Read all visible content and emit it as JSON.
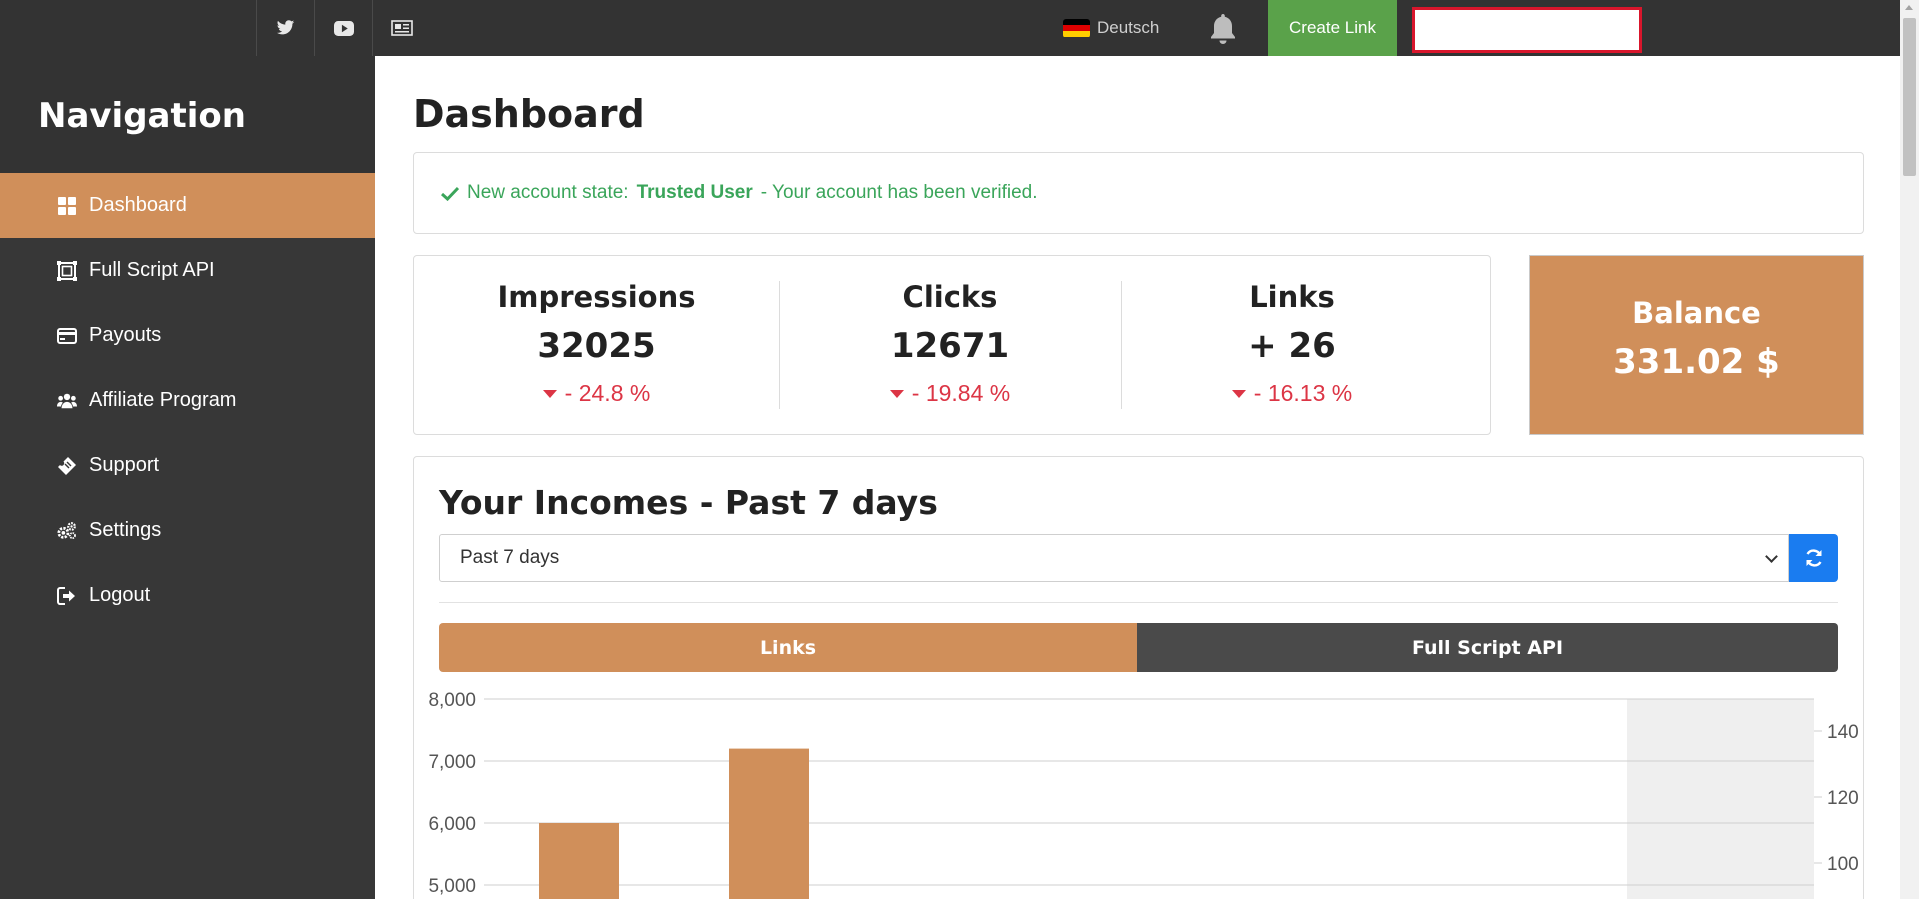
{
  "topbar": {
    "social": [
      "twitter-icon",
      "youtube-icon",
      "news-icon"
    ],
    "language": "Deutsch",
    "create_link": "Create Link",
    "search_value": ""
  },
  "colors": {
    "accent": "#d08f5a",
    "dark": "#373737",
    "green": "#5aa24a",
    "success_text": "#3aa55a",
    "negative": "#dc3545",
    "primary_blue": "#1a7cf0"
  },
  "sidebar": {
    "title": "Navigation",
    "items": [
      {
        "label": "Dashboard",
        "icon": "dashboard-icon",
        "active": true
      },
      {
        "label": "Full Script API",
        "icon": "script-icon",
        "active": false
      },
      {
        "label": "Payouts",
        "icon": "credit-card-icon",
        "active": false
      },
      {
        "label": "Affiliate Program",
        "icon": "users-icon",
        "active": false
      },
      {
        "label": "Support",
        "icon": "ticket-icon",
        "active": false
      },
      {
        "label": "Settings",
        "icon": "gears-icon",
        "active": false
      },
      {
        "label": "Logout",
        "icon": "logout-icon",
        "active": false
      }
    ]
  },
  "main": {
    "title": "Dashboard",
    "alert": {
      "prefix": "New account state:",
      "state": "Trusted User",
      "suffix": "- Your account has been verified."
    },
    "stats": [
      {
        "label": "Impressions",
        "value": "32025",
        "change": "- 24.8 %"
      },
      {
        "label": "Clicks",
        "value": "12671",
        "change": "- 19.84 %"
      },
      {
        "label": "Links",
        "value": "+ 26",
        "change": "- 16.13 %"
      }
    ],
    "balance": {
      "label": "Balance",
      "value": "331.02 $"
    },
    "income": {
      "title": "Your Incomes - Past 7 days",
      "range_selected": "Past 7 days",
      "tabs": [
        "Links",
        "Full Script API"
      ]
    }
  },
  "chart_data": {
    "type": "bar",
    "left_axis": {
      "ticks": [
        "8,000",
        "7,000",
        "6,000",
        "5,000"
      ],
      "ylim_visible": [
        5000,
        8000
      ]
    },
    "right_axis": {
      "ticks": [
        "140",
        "120",
        "100"
      ]
    },
    "bar_color": "#d08f5a",
    "bars": [
      {
        "slot": 1,
        "value": 6000
      },
      {
        "slot": 2,
        "value": 7200
      }
    ],
    "highlighted_slot": 7,
    "grid": true
  }
}
